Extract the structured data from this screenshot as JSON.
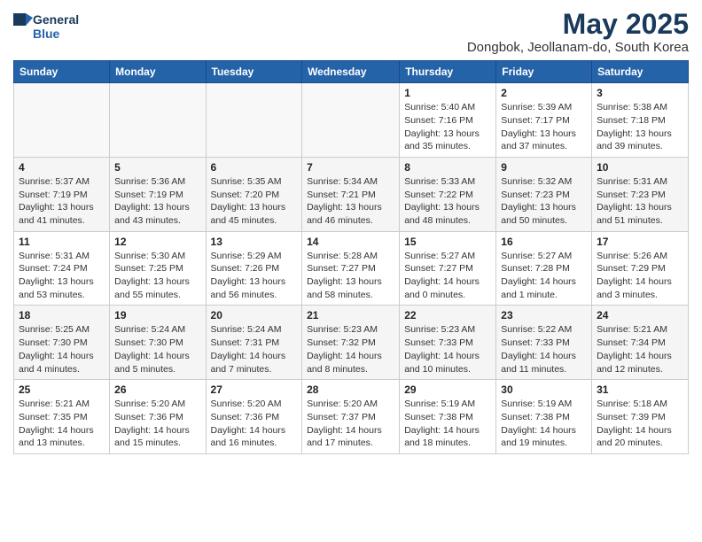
{
  "header": {
    "logo_general": "General",
    "logo_blue": "Blue",
    "month_title": "May 2025",
    "location": "Dongbok, Jeollanam-do, South Korea"
  },
  "weekdays": [
    "Sunday",
    "Monday",
    "Tuesday",
    "Wednesday",
    "Thursday",
    "Friday",
    "Saturday"
  ],
  "weeks": [
    [
      {
        "day": "",
        "info": ""
      },
      {
        "day": "",
        "info": ""
      },
      {
        "day": "",
        "info": ""
      },
      {
        "day": "",
        "info": ""
      },
      {
        "day": "1",
        "info": "Sunrise: 5:40 AM\nSunset: 7:16 PM\nDaylight: 13 hours\nand 35 minutes."
      },
      {
        "day": "2",
        "info": "Sunrise: 5:39 AM\nSunset: 7:17 PM\nDaylight: 13 hours\nand 37 minutes."
      },
      {
        "day": "3",
        "info": "Sunrise: 5:38 AM\nSunset: 7:18 PM\nDaylight: 13 hours\nand 39 minutes."
      }
    ],
    [
      {
        "day": "4",
        "info": "Sunrise: 5:37 AM\nSunset: 7:19 PM\nDaylight: 13 hours\nand 41 minutes."
      },
      {
        "day": "5",
        "info": "Sunrise: 5:36 AM\nSunset: 7:19 PM\nDaylight: 13 hours\nand 43 minutes."
      },
      {
        "day": "6",
        "info": "Sunrise: 5:35 AM\nSunset: 7:20 PM\nDaylight: 13 hours\nand 45 minutes."
      },
      {
        "day": "7",
        "info": "Sunrise: 5:34 AM\nSunset: 7:21 PM\nDaylight: 13 hours\nand 46 minutes."
      },
      {
        "day": "8",
        "info": "Sunrise: 5:33 AM\nSunset: 7:22 PM\nDaylight: 13 hours\nand 48 minutes."
      },
      {
        "day": "9",
        "info": "Sunrise: 5:32 AM\nSunset: 7:23 PM\nDaylight: 13 hours\nand 50 minutes."
      },
      {
        "day": "10",
        "info": "Sunrise: 5:31 AM\nSunset: 7:23 PM\nDaylight: 13 hours\nand 51 minutes."
      }
    ],
    [
      {
        "day": "11",
        "info": "Sunrise: 5:31 AM\nSunset: 7:24 PM\nDaylight: 13 hours\nand 53 minutes."
      },
      {
        "day": "12",
        "info": "Sunrise: 5:30 AM\nSunset: 7:25 PM\nDaylight: 13 hours\nand 55 minutes."
      },
      {
        "day": "13",
        "info": "Sunrise: 5:29 AM\nSunset: 7:26 PM\nDaylight: 13 hours\nand 56 minutes."
      },
      {
        "day": "14",
        "info": "Sunrise: 5:28 AM\nSunset: 7:27 PM\nDaylight: 13 hours\nand 58 minutes."
      },
      {
        "day": "15",
        "info": "Sunrise: 5:27 AM\nSunset: 7:27 PM\nDaylight: 14 hours\nand 0 minutes."
      },
      {
        "day": "16",
        "info": "Sunrise: 5:27 AM\nSunset: 7:28 PM\nDaylight: 14 hours\nand 1 minute."
      },
      {
        "day": "17",
        "info": "Sunrise: 5:26 AM\nSunset: 7:29 PM\nDaylight: 14 hours\nand 3 minutes."
      }
    ],
    [
      {
        "day": "18",
        "info": "Sunrise: 5:25 AM\nSunset: 7:30 PM\nDaylight: 14 hours\nand 4 minutes."
      },
      {
        "day": "19",
        "info": "Sunrise: 5:24 AM\nSunset: 7:30 PM\nDaylight: 14 hours\nand 5 minutes."
      },
      {
        "day": "20",
        "info": "Sunrise: 5:24 AM\nSunset: 7:31 PM\nDaylight: 14 hours\nand 7 minutes."
      },
      {
        "day": "21",
        "info": "Sunrise: 5:23 AM\nSunset: 7:32 PM\nDaylight: 14 hours\nand 8 minutes."
      },
      {
        "day": "22",
        "info": "Sunrise: 5:23 AM\nSunset: 7:33 PM\nDaylight: 14 hours\nand 10 minutes."
      },
      {
        "day": "23",
        "info": "Sunrise: 5:22 AM\nSunset: 7:33 PM\nDaylight: 14 hours\nand 11 minutes."
      },
      {
        "day": "24",
        "info": "Sunrise: 5:21 AM\nSunset: 7:34 PM\nDaylight: 14 hours\nand 12 minutes."
      }
    ],
    [
      {
        "day": "25",
        "info": "Sunrise: 5:21 AM\nSunset: 7:35 PM\nDaylight: 14 hours\nand 13 minutes."
      },
      {
        "day": "26",
        "info": "Sunrise: 5:20 AM\nSunset: 7:36 PM\nDaylight: 14 hours\nand 15 minutes."
      },
      {
        "day": "27",
        "info": "Sunrise: 5:20 AM\nSunset: 7:36 PM\nDaylight: 14 hours\nand 16 minutes."
      },
      {
        "day": "28",
        "info": "Sunrise: 5:20 AM\nSunset: 7:37 PM\nDaylight: 14 hours\nand 17 minutes."
      },
      {
        "day": "29",
        "info": "Sunrise: 5:19 AM\nSunset: 7:38 PM\nDaylight: 14 hours\nand 18 minutes."
      },
      {
        "day": "30",
        "info": "Sunrise: 5:19 AM\nSunset: 7:38 PM\nDaylight: 14 hours\nand 19 minutes."
      },
      {
        "day": "31",
        "info": "Sunrise: 5:18 AM\nSunset: 7:39 PM\nDaylight: 14 hours\nand 20 minutes."
      }
    ]
  ]
}
